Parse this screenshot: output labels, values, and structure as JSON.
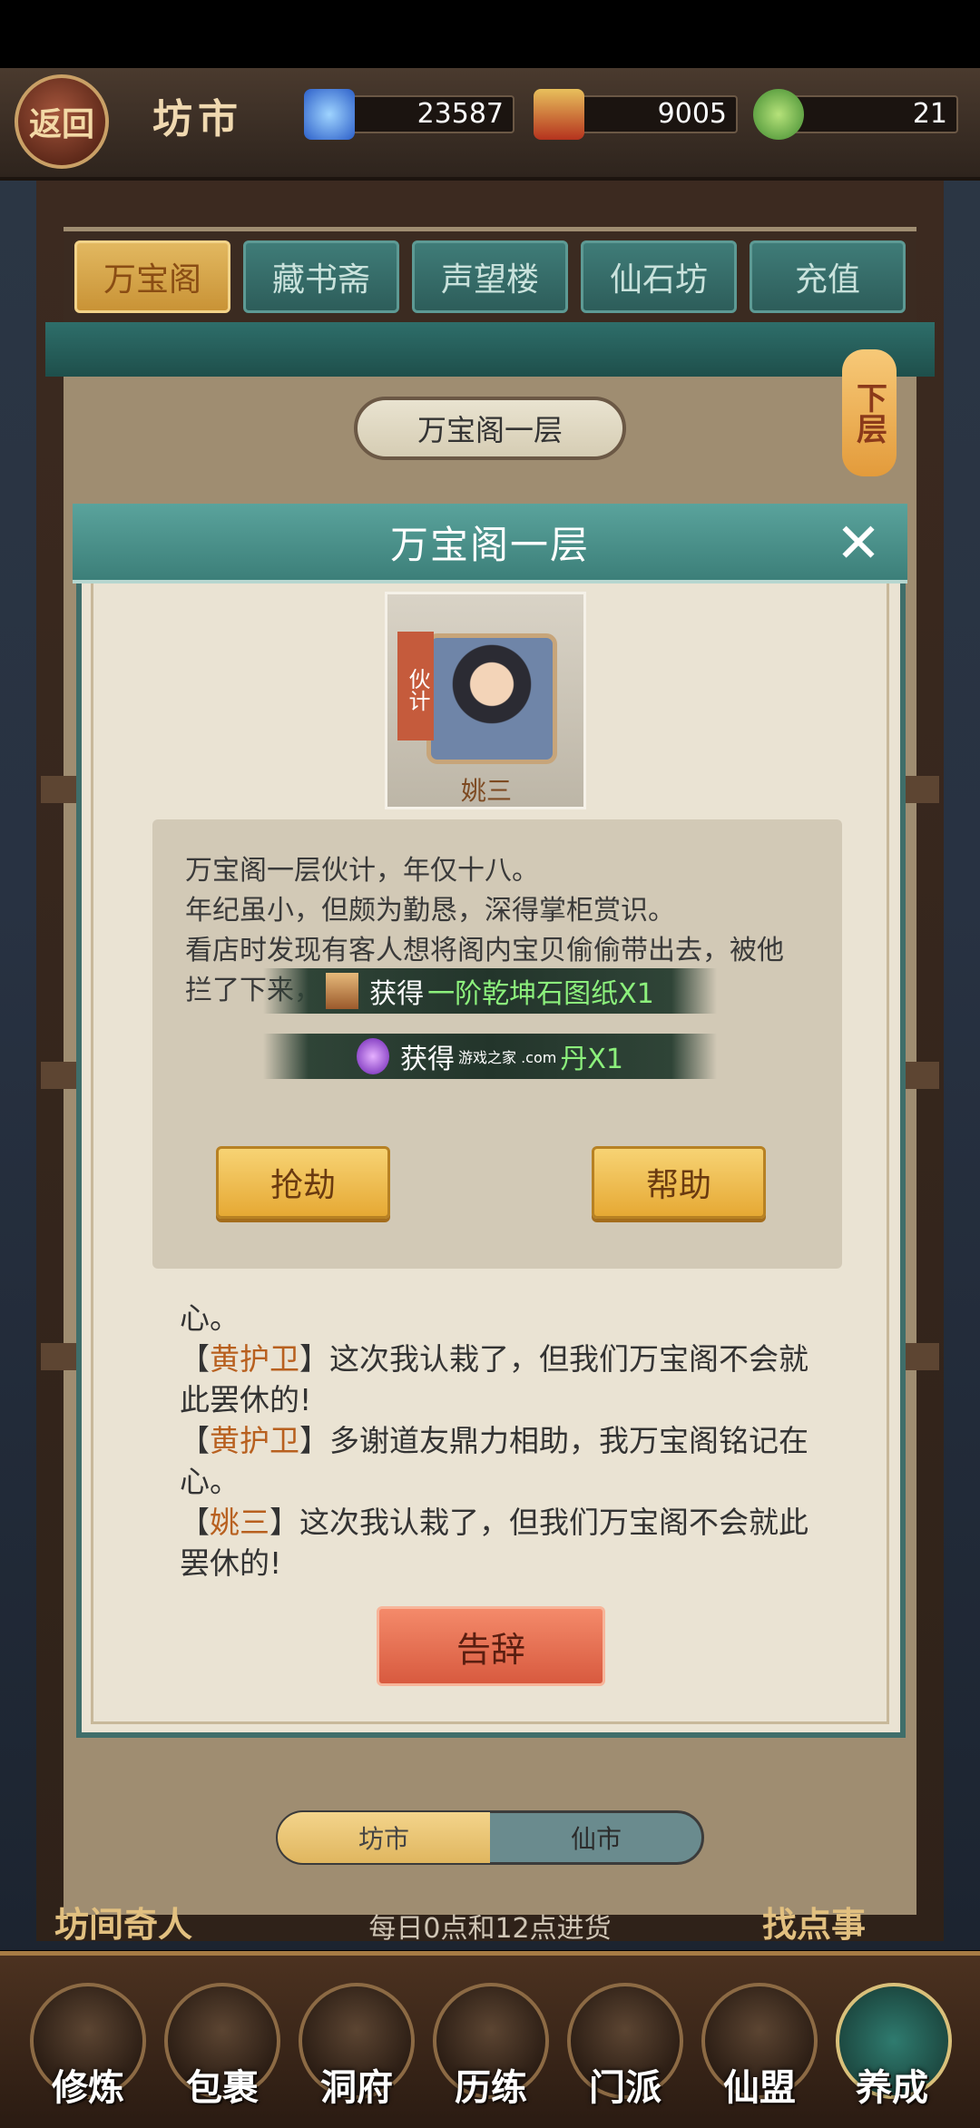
{
  "header": {
    "back_label": "返回",
    "title": "坊市",
    "resources": [
      {
        "icon": "spirit-crystal-icon",
        "value": "23587"
      },
      {
        "icon": "red-envelope-icon",
        "value": "9005"
      },
      {
        "icon": "jade-coin-icon",
        "value": "21"
      }
    ]
  },
  "tabs": [
    "万宝阁",
    "藏书斋",
    "声望楼",
    "仙石坊",
    "充值"
  ],
  "floor": {
    "current": "万宝阁一层",
    "next_label": "下层"
  },
  "dialog": {
    "title": "万宝阁一层",
    "npc": {
      "role": "伙计",
      "name": "姚三"
    },
    "story": [
      "万宝阁一层伙计，年仅十八。",
      "年纪虽小，但颇为勤恳，深得掌柜赏识。",
      "看店时发现有客人想将阁内宝贝偷偷带出去，被他",
      "拦了下来，但"
    ],
    "rewards": [
      {
        "prefix": "获得",
        "item": "一阶乾坤石图纸X1",
        "icon": "blueprint-scroll-icon"
      },
      {
        "prefix": "获得",
        "item": "丹X1",
        "icon": "purple-pill-icon",
        "watermark": "游戏之家 .com"
      }
    ],
    "actions": {
      "rob": "抢劫",
      "help": "帮助"
    },
    "log": [
      {
        "who": "",
        "text": "心。"
      },
      {
        "who": "黄护卫",
        "text": "这次我认栽了，但我们万宝阁不会就此罢休的!"
      },
      {
        "who": "黄护卫",
        "text": "多谢道友鼎力相助，我万宝阁铭记在心。"
      },
      {
        "who": "姚三",
        "text": "这次我认栽了，但我们万宝阁不会就此罢休的!"
      }
    ],
    "farewell": "告辞"
  },
  "market_switch": {
    "left": "坊市",
    "right": "仙市",
    "selected": "坊市"
  },
  "restock_note": "每日0点和12点进货",
  "side_buttons": {
    "merchant": "坊间奇人",
    "errand": "找点事"
  },
  "nav": [
    {
      "label": "修炼",
      "icon": "cultivator-icon"
    },
    {
      "label": "包裹",
      "icon": "bag-icon"
    },
    {
      "label": "洞府",
      "icon": "cave-mansion-icon"
    },
    {
      "label": "历练",
      "icon": "scroll-map-icon"
    },
    {
      "label": "门派",
      "icon": "sect-gate-icon"
    },
    {
      "label": "仙盟",
      "icon": "alliance-crown-icon"
    },
    {
      "label": "养成",
      "icon": "pentagram-icon"
    }
  ]
}
